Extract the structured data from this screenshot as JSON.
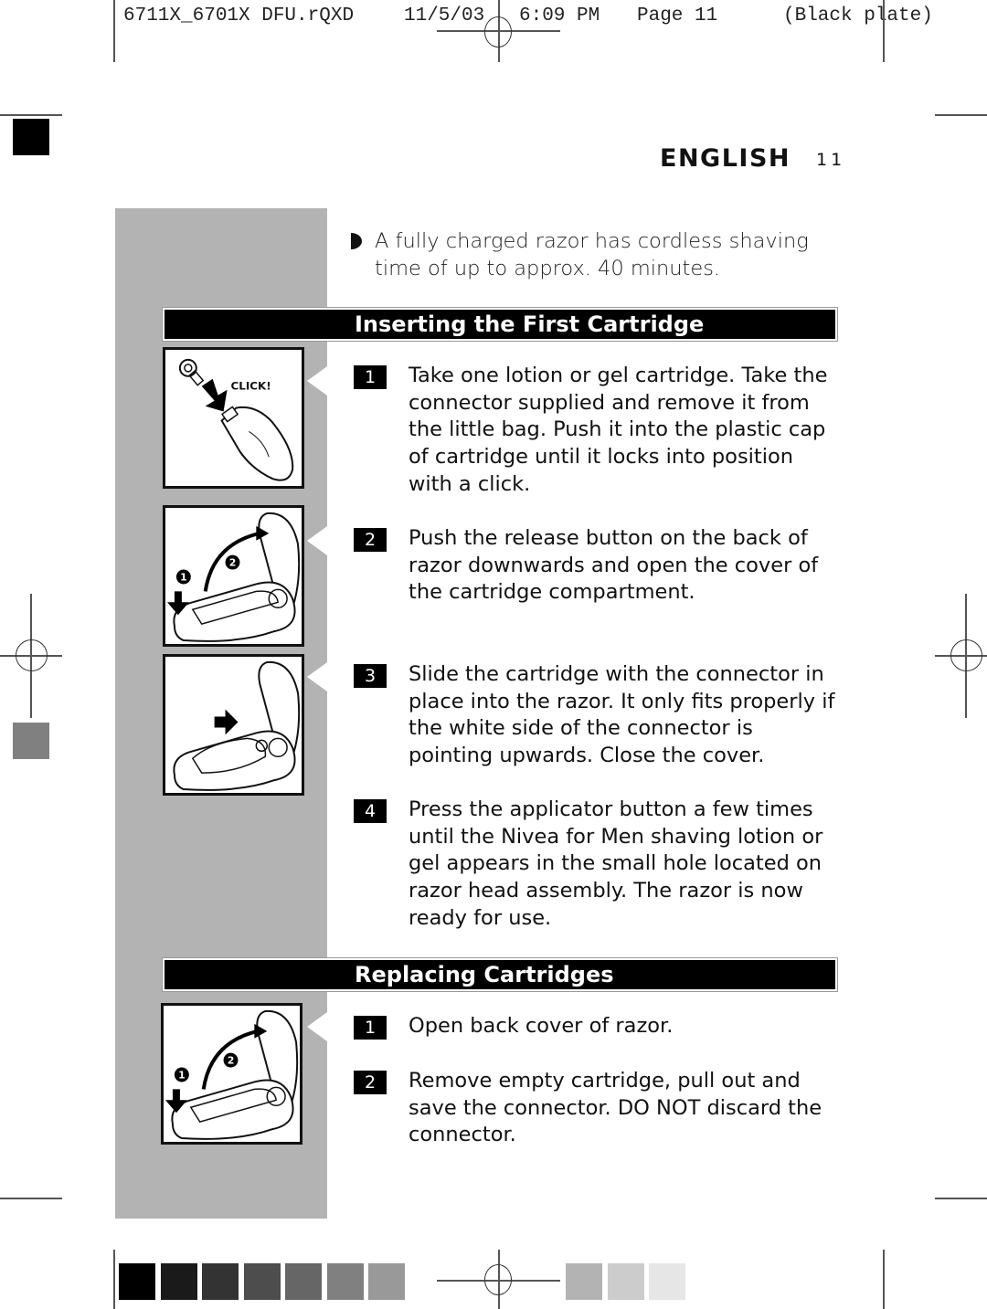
{
  "slug": {
    "filename": "6711X_6701X DFU.rQXD",
    "date": "11/5/03",
    "time": "6:09 PM",
    "page": "Page 11",
    "plate": "(Black plate)"
  },
  "header": {
    "language": "ENGLISH",
    "page_number": "11"
  },
  "intro_bullet": {
    "icon": "half-circle-bullet-icon",
    "text": "A fully charged razor has cordless shaving time of up to approx. 40 minutes."
  },
  "sections": [
    {
      "title": "Inserting the First Cartridge",
      "steps": [
        {
          "number": "1",
          "text": "Take one lotion or gel cartridge. Take the connector supplied and remove it from the little bag. Push it into the plastic cap of cartridge until it locks into position with a click."
        },
        {
          "number": "2",
          "text": "Push the release button on the back of razor downwards and open the cover of the cartridge compartment."
        },
        {
          "number": "3",
          "text": "Slide the cartridge with the connector in place into the razor. It only fits properly if the white side of the connector is pointing upwards. Close the cover."
        },
        {
          "number": "4",
          "text": "Press the applicator button a few times until the Nivea for Men shaving lotion or gel appears in the small hole located on razor head assembly. The razor is now ready for use."
        }
      ],
      "figures": [
        {
          "name": "connector-cartridge-illustration",
          "label": "CLICK!"
        },
        {
          "name": "open-cover-illustration",
          "callouts": [
            "1",
            "2"
          ]
        },
        {
          "name": "slide-cartridge-illustration"
        }
      ]
    },
    {
      "title": "Replacing Cartridges",
      "steps": [
        {
          "number": "1",
          "text": "Open back cover of razor."
        },
        {
          "number": "2",
          "text": "Remove empty cartridge, pull out and save the connector. DO NOT discard the connector."
        }
      ],
      "figures": [
        {
          "name": "open-back-cover-illustration",
          "callouts": [
            "1",
            "2"
          ]
        }
      ]
    }
  ],
  "color_bar": {
    "left_swatches": [
      "#000000",
      "#1a1a1a",
      "#333333",
      "#4d4d4d",
      "#666666",
      "#808080",
      "#999999"
    ],
    "right_swatches": [
      "#b3b3b3",
      "#cccccc",
      "#e6e6e6"
    ]
  },
  "side_marks": {
    "top_square": "#000000",
    "mid_square": "#808080"
  }
}
